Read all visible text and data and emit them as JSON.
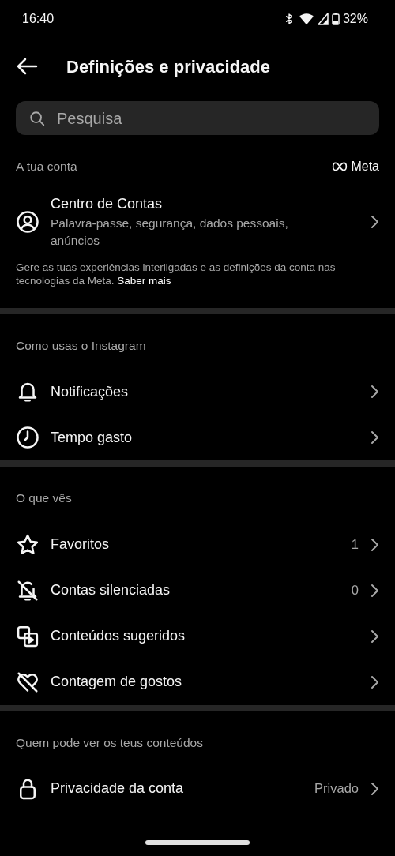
{
  "status_bar": {
    "time": "16:40",
    "battery": "32%"
  },
  "header": {
    "title": "Definições e privacidade"
  },
  "search": {
    "placeholder": "Pesquisa"
  },
  "sections": [
    {
      "title": "A tua conta",
      "brand": "Meta",
      "items": [
        {
          "kind": "user",
          "label": "Centro de Contas",
          "subtitle": "Palavra-passe, segurança, dados pessoais, anúncios"
        }
      ],
      "note": "Gere as tuas experiências interligadas e as definições da conta nas tecnologias da Meta.",
      "note_link": "Saber mais"
    },
    {
      "title": "Como usas o Instagram",
      "items": [
        {
          "kind": "bell",
          "label": "Notificações"
        },
        {
          "kind": "clock",
          "label": "Tempo gasto"
        }
      ]
    },
    {
      "title": "O que vês",
      "items": [
        {
          "kind": "star",
          "label": "Favoritos",
          "value": "1"
        },
        {
          "kind": "bell-off",
          "label": "Contas silenciadas",
          "value": "0"
        },
        {
          "kind": "media",
          "label": "Conteúdos sugeridos"
        },
        {
          "kind": "heart-off",
          "label": "Contagem de gostos"
        }
      ]
    },
    {
      "title": "Quem pode ver os teus conteúdos",
      "items": [
        {
          "kind": "lock",
          "label": "Privacidade da conta",
          "value": "Privado"
        }
      ]
    }
  ]
}
